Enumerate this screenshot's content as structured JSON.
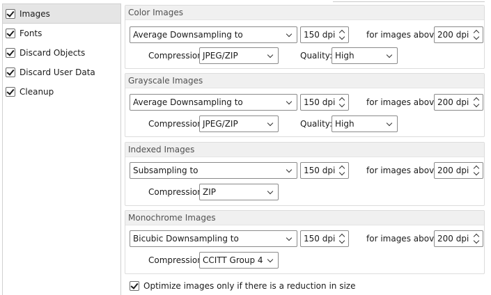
{
  "sidebar": {
    "items": [
      {
        "label": "Images",
        "checked": true,
        "selected": true
      },
      {
        "label": "Fonts",
        "checked": true
      },
      {
        "label": "Discard Objects",
        "checked": true
      },
      {
        "label": "Discard User Data",
        "checked": true
      },
      {
        "label": "Cleanup",
        "checked": true
      }
    ]
  },
  "groups": {
    "color": {
      "title": "Color Images",
      "method": "Average Downsampling to",
      "dpi": "150 dpi",
      "above_label": "for images above:",
      "above_dpi": "200 dpi",
      "compression_label": "Compression",
      "compression": "JPEG/ZIP",
      "quality_label": "Quality:",
      "quality": "High"
    },
    "gray": {
      "title": "Grayscale Images",
      "method": "Average Downsampling to",
      "dpi": "150 dpi",
      "above_label": "for images above:",
      "above_dpi": "200 dpi",
      "compression_label": "Compression",
      "compression": "JPEG/ZIP",
      "quality_label": "Quality:",
      "quality": "High"
    },
    "indexed": {
      "title": "Indexed Images",
      "method": "Subsampling to",
      "dpi": "150 dpi",
      "above_label": "for images above:",
      "above_dpi": "200 dpi",
      "compression_label": "Compression",
      "compression": "ZIP"
    },
    "mono": {
      "title": "Monochrome Images",
      "method": "Bicubic Downsampling to",
      "dpi": "150 dpi",
      "above_label": "for images above:",
      "above_dpi": "200 dpi",
      "compression_label": "Compression",
      "compression": "CCITT Group 4"
    }
  },
  "optimize": {
    "label": "Optimize images only if there is a reduction in size",
    "checked": true
  }
}
